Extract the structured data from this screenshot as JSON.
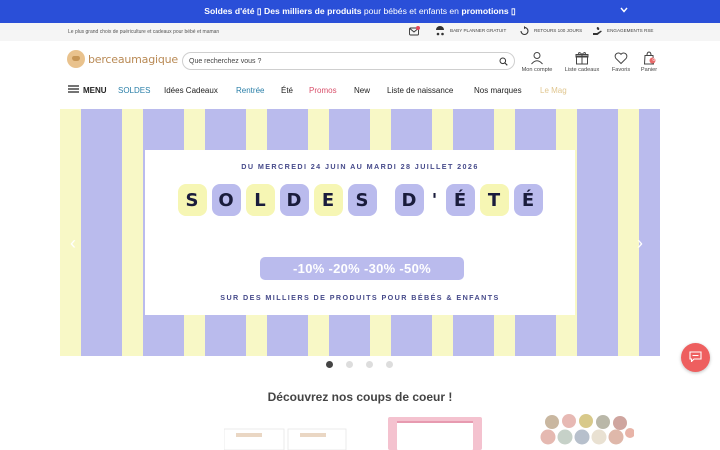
{
  "promo": {
    "strong1": "Soldes d'été ▯ Des milliers de produits",
    "mid": " pour bébés et enfants en ",
    "strong2": "promotions ▯",
    "chevron": "⌄"
  },
  "strip": {
    "tagline": "Le plus grand choix de puériculture et cadeaux pour bébé et maman",
    "notif_count": "1",
    "items": [
      "Baby planner gratuit",
      "Retours 100 jours",
      "Engagements RSE"
    ]
  },
  "header": {
    "logo_text": "berceaumagique",
    "search_placeholder": "Que recherchez vous ?",
    "account": "Mon compte",
    "gift_list": "Liste cadeaux",
    "favorites": "Favoris",
    "cart": "Panier",
    "cart_count": "0"
  },
  "nav": {
    "menu": "MENU",
    "items": [
      "SOLDES",
      "Idées Cadeaux",
      "Rentrée",
      "Été",
      "Promos",
      "New",
      "Liste de naissance",
      "Nos marques",
      "Le Mag"
    ]
  },
  "banner": {
    "dates": "DU MERCREDI 24 JUIN AU MARDI 28 JUILLET 2026",
    "title_letters": [
      "S",
      "O",
      "L",
      "D",
      "E",
      "S",
      " ",
      "D",
      "'",
      "É",
      "T",
      "É"
    ],
    "tile_colors": [
      "#f6f6b4",
      "#babbed",
      "#f6f6b4",
      "#babbed",
      "#f6f6b4",
      "#babbed",
      "",
      "#babbed",
      "#f6f6b4",
      "#babbed",
      "#f6f6b4",
      "#babbed"
    ],
    "discounts": "-10% -20% -30% -50%",
    "subtitle": "SUR DES MILLIERS DE PRODUITS POUR BÉBÉS & ENFANTS",
    "prev": "‹",
    "next": "›"
  },
  "carousel": {
    "count": 4,
    "active": 0
  },
  "section": {
    "title": "Découvrez nos coups de coeur !"
  },
  "colors": {
    "promo_bg": "#2a4fd8",
    "accent_blue": "#2a7fa8",
    "promo_red": "#d94f6a",
    "mag_gold": "#e0c68f",
    "chat": "#ee5f5f"
  }
}
